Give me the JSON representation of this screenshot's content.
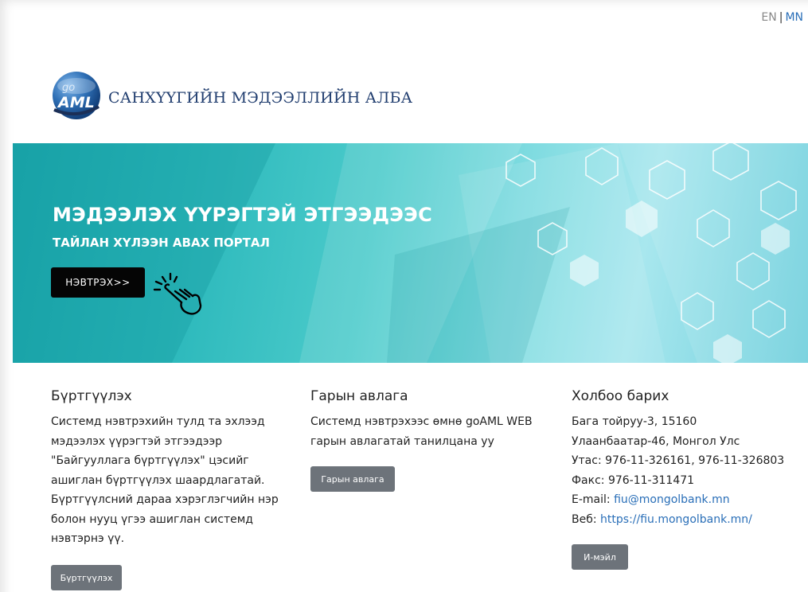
{
  "lang": {
    "en": "EN",
    "separator": "|",
    "mn": "MN"
  },
  "brand": {
    "logo_text_top": "go",
    "logo_text_main": "AML",
    "name": "САНХҮҮГИЙН МЭДЭЭЛЛИЙН АЛБА"
  },
  "hero": {
    "title": "МЭДЭЭЛЭХ ҮҮРЭГТЭЙ ЭТГЭЭДЭЭС",
    "subtitle": "ТАЙЛАН ХҮЛЭЭН АВАХ ПОРТАЛ",
    "login_label": "НЭВТРЭХ>>",
    "hand_icon": "pointing-hand-icon"
  },
  "register": {
    "heading": "Бүртгүүлэх",
    "text": "Системд нэвтрэхийн тулд та эхлээд мэдээлэх үүрэгтэй этгээдээр \"Байгууллага бүртгүүлэх\" цэсийг ашиглан бүртгүүлэх шаардлагатай. Бүртгүүлсний дараа хэрэглэгчийн нэр болон нууц үгээ ашиглан системд нэвтэрнэ үү.",
    "button": "Бүртгүүлэх"
  },
  "guide": {
    "heading": "Гарын авлага",
    "text": "Системд нэвтрэхээс өмнө goAML WEB гарын авлагатай танилцана уу",
    "button": "Гарын авлага"
  },
  "contact": {
    "heading": "Холбоо барих",
    "address1": "Бага тойруу-3, 15160",
    "address2": "Улаанбаатар-46, Монгол Улс",
    "phone": "Утас: 976-11-326161, 976-11-326803",
    "fax": "Факс: 976-11-311471",
    "email_label": "E-mail: ",
    "email": "fiu@mongolbank.mn",
    "web_label": "Веб: ",
    "web": "https://fiu.mongolbank.mn/",
    "button": "И-мэйл"
  },
  "colors": {
    "accent": "#2a6fb8",
    "hero": "#2bb8bb",
    "button_dark": "#050505",
    "button_gray": "#6d737a",
    "brand_text": "#1f3c6e"
  }
}
